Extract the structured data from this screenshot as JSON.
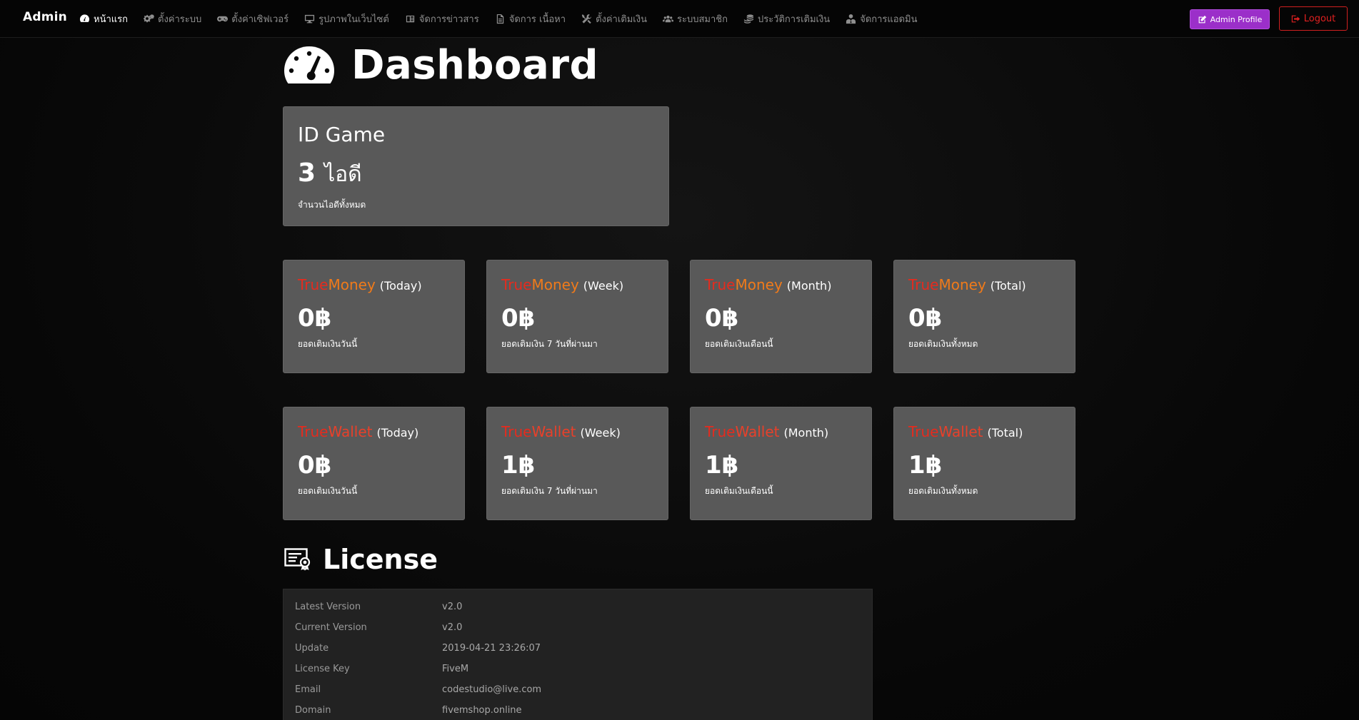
{
  "navbar": {
    "brand": "Admin",
    "items": [
      {
        "label": "หน้าแรก",
        "icon": "dashboard-icon",
        "active": true
      },
      {
        "label": "ตั้งค่าระบบ",
        "icon": "cogs-icon"
      },
      {
        "label": "ตั้งค่าเซิฟเวอร์",
        "icon": "gamepad-icon"
      },
      {
        "label": "รูปภาพในเว็บไซต์",
        "icon": "desktop-icon"
      },
      {
        "label": "จัดการข่าวสาร",
        "icon": "newspaper-icon"
      },
      {
        "label": "จัดการ เนื้อหา",
        "icon": "file-icon"
      },
      {
        "label": "ตั้งค่าเติมเงิน",
        "icon": "tools-icon"
      },
      {
        "label": "ระบบสมาชิก",
        "icon": "users-icon"
      },
      {
        "label": "ประวัติการเติมเงิน",
        "icon": "coins-icon"
      },
      {
        "label": "จัดการแอดมิน",
        "icon": "user-tie-icon"
      }
    ],
    "profile_button": "Admin Profile",
    "logout_button": "Logout"
  },
  "page": {
    "title": "Dashboard"
  },
  "id_card": {
    "title": "ID Game",
    "count": "3",
    "unit": "ไอดี",
    "desc": "จำนวนไอดีทั้งหมด"
  },
  "truemoney": {
    "brand_a": "True",
    "brand_b": "Money",
    "cards": [
      {
        "period": "(Today)",
        "value": "0฿",
        "desc": "ยอดเติมเงินวันนี้"
      },
      {
        "period": "(Week)",
        "value": "0฿",
        "desc": "ยอดเติมเงิน 7 วันที่ผ่านมา"
      },
      {
        "period": "(Month)",
        "value": "0฿",
        "desc": "ยอดเติมเงินเดือนนี้"
      },
      {
        "period": "(Total)",
        "value": "0฿",
        "desc": "ยอดเติมเงินทั้งหมด"
      }
    ]
  },
  "truewallet": {
    "brand_a": "True",
    "brand_b": "Wallet",
    "cards": [
      {
        "period": "(Today)",
        "value": "0฿",
        "desc": "ยอดเติมเงินวันนี้"
      },
      {
        "period": "(Week)",
        "value": "1฿",
        "desc": "ยอดเติมเงิน 7 วันที่ผ่านมา"
      },
      {
        "period": "(Month)",
        "value": "1฿",
        "desc": "ยอดเติมเงินเดือนนี้"
      },
      {
        "period": "(Total)",
        "value": "1฿",
        "desc": "ยอดเติมเงินทั้งหมด"
      }
    ]
  },
  "license": {
    "title": "License",
    "rows": [
      {
        "key": "Latest Version",
        "value": "v2.0"
      },
      {
        "key": "Current Version",
        "value": "v2.0"
      },
      {
        "key": "Update",
        "value": "2019-04-21 23:26:07"
      },
      {
        "key": "License Key",
        "value": "FiveM"
      },
      {
        "key": "Email",
        "value": "codestudio@live.com"
      },
      {
        "key": "Domain",
        "value": "fivemshop.online"
      }
    ]
  },
  "colors": {
    "true_red": "#e52b1e",
    "money_orange": "#f07a1a",
    "wallet_red": "#e8402a",
    "profile_purple": "#9b2fc9",
    "logout_red": "#e02020",
    "card_bg": "#595959"
  }
}
